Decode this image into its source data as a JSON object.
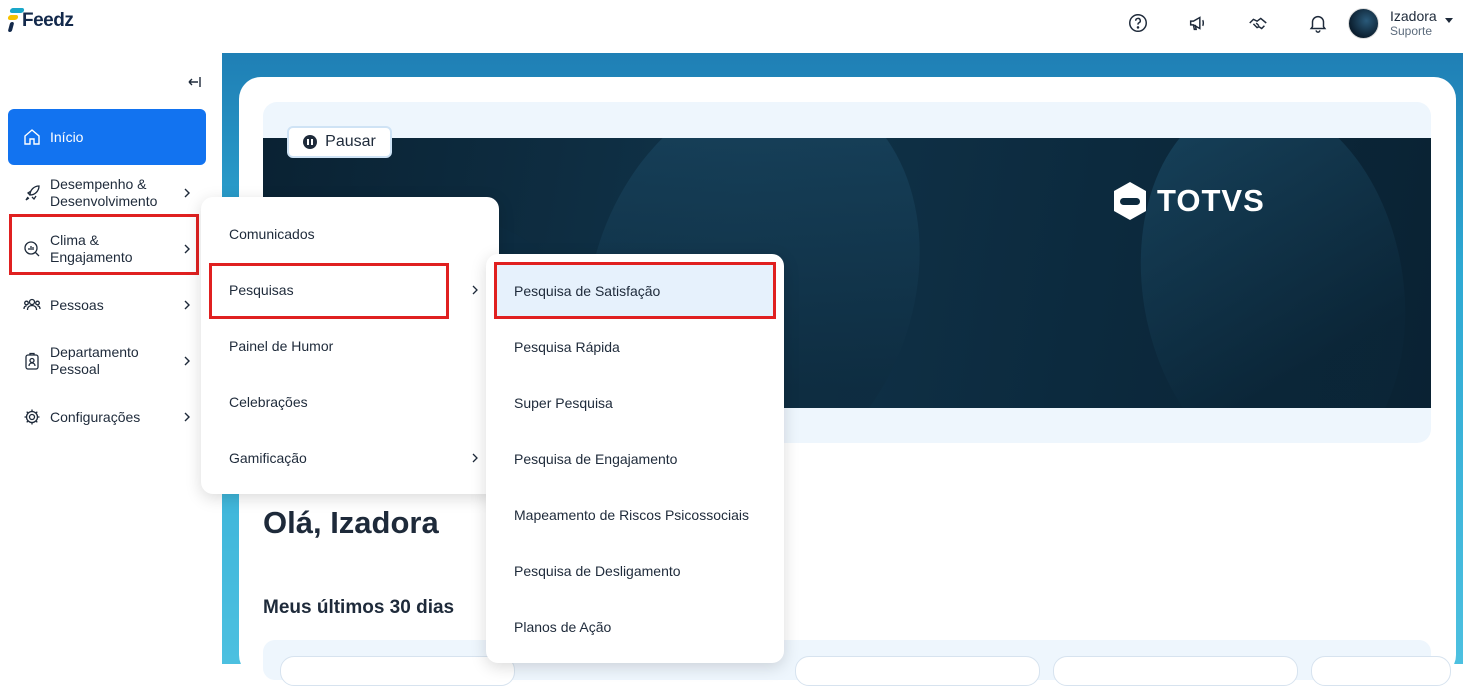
{
  "brand": {
    "name": "Feedz"
  },
  "topbar": {
    "icons": [
      "help-icon",
      "megaphone-icon",
      "handshake-icon",
      "bell-icon"
    ],
    "user": {
      "name": "Izadora",
      "role": "Suporte"
    }
  },
  "sidebar": {
    "items": [
      {
        "label": "Início",
        "icon": "home-icon",
        "active": true
      },
      {
        "label": "Desempenho & Desenvolvimento",
        "icon": "rocket-icon"
      },
      {
        "label": "Clima & Engajamento",
        "icon": "magnifier-chart-icon"
      },
      {
        "label": "Pessoas",
        "icon": "people-icon"
      },
      {
        "label": "Departamento Pessoal",
        "icon": "badge-icon"
      },
      {
        "label": "Configurações",
        "icon": "gear-icon"
      }
    ]
  },
  "banner": {
    "pause_label": "Pausar",
    "brand_text": "TOTVS"
  },
  "main": {
    "greeting": "Olá, Izadora",
    "subheading": "Meus últimos 30 dias"
  },
  "submenu_clima": {
    "items": [
      {
        "label": "Comunicados"
      },
      {
        "label": "Pesquisas",
        "has_children": true
      },
      {
        "label": "Painel de Humor"
      },
      {
        "label": "Celebrações"
      },
      {
        "label": "Gamificação",
        "has_children": true
      }
    ]
  },
  "submenu_pesquisas": {
    "items": [
      {
        "label": "Pesquisa de Satisfação",
        "selected": true
      },
      {
        "label": "Pesquisa Rápida"
      },
      {
        "label": "Super Pesquisa"
      },
      {
        "label": "Pesquisa de Engajamento"
      },
      {
        "label": "Mapeamento de Riscos Psicossociais"
      },
      {
        "label": "Pesquisa de Desligamento"
      },
      {
        "label": "Planos de Ação"
      }
    ]
  },
  "colors": {
    "accent": "#1273f0",
    "highlight_box": "#e02020",
    "navy": "#13294b"
  }
}
